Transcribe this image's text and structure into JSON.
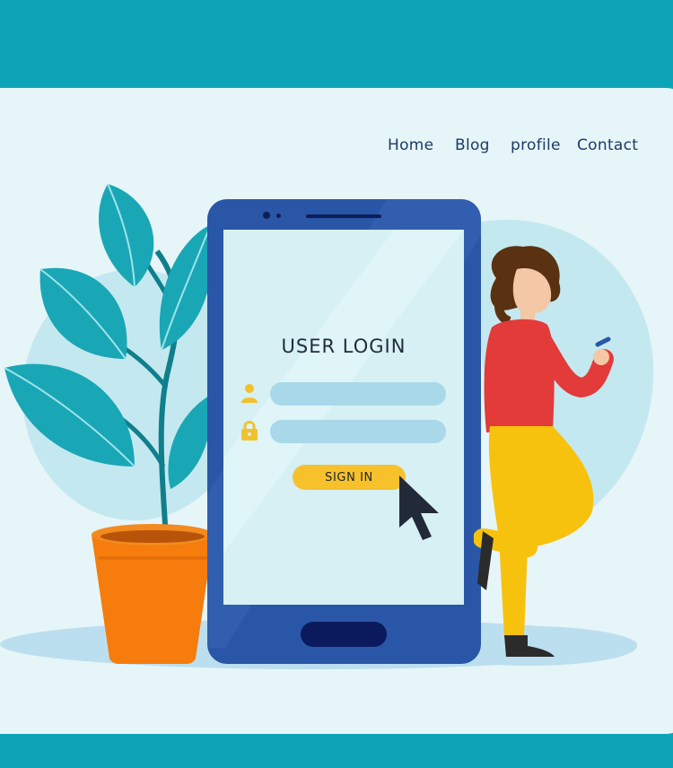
{
  "nav": {
    "items": [
      "Home",
      "Blog",
      "profile",
      "Contact"
    ]
  },
  "login": {
    "title": "USER LOGIN",
    "username_placeholder": "",
    "password_placeholder": "",
    "signin_label": "SIGN IN"
  },
  "colors": {
    "background": "#0ea4b8",
    "panel": "#e6f5f8",
    "phone_body": "#2a56a8",
    "phone_screen": "#d6f0f4",
    "input_fill": "#a9d8e8",
    "button": "#f7c12b",
    "nav_text": "#1e3a66",
    "leaf": "#1aa7b5",
    "pot": "#f57c0d"
  },
  "icons": [
    "user-icon",
    "lock-icon",
    "cursor-pointer-icon"
  ]
}
